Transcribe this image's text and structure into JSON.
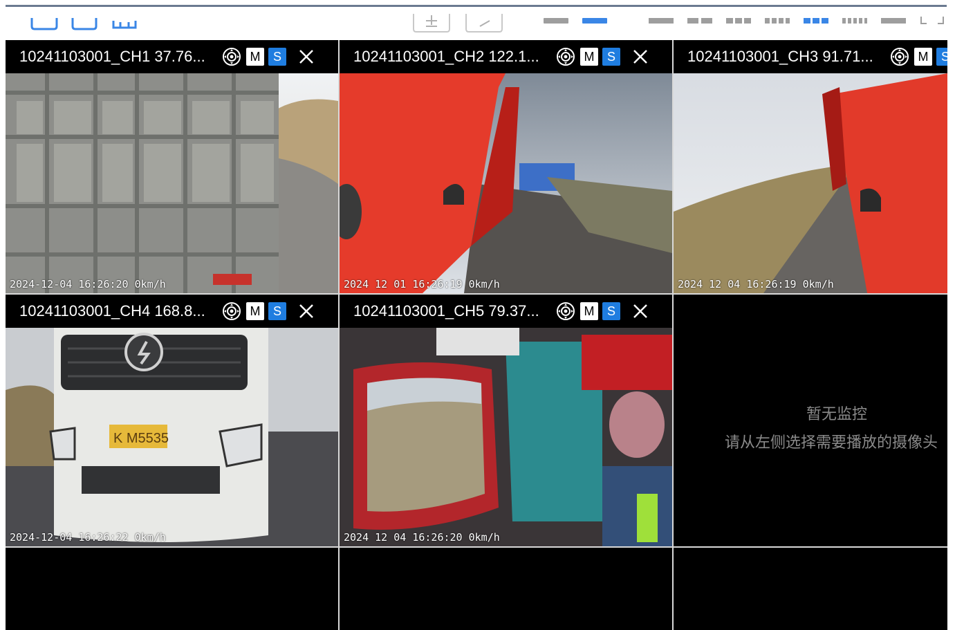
{
  "colors": {
    "accent": "#1f7de0",
    "grid_bg": "#000000",
    "divider": "#d9d9d9",
    "empty_text": "#8a8a8a"
  },
  "toolbar": {
    "left_icons": [
      "monitor-icon",
      "window-icon",
      "table-icon"
    ],
    "middle_icons": [
      "download-icon",
      "link-icon"
    ],
    "layout_icons": [
      "layout-1-icon",
      "layout-2-icon",
      "layout-4-icon",
      "layout-6-icon",
      "layout-8-icon",
      "layout-9-icon",
      "layout-12-icon",
      "layout-16-icon",
      "layout-custom-icon",
      "fullscreen-icon"
    ],
    "active_layout": "layout-9-icon"
  },
  "tiles": [
    {
      "title": "10241103001_CH1 37.76...",
      "timestamp": "2024-12-04 16:26:20 0km/h",
      "m_label": "M",
      "s_label": "S"
    },
    {
      "title": "10241103001_CH2 122.1...",
      "timestamp": "2024 12 01 16:26:19 0km/h",
      "m_label": "M",
      "s_label": "S"
    },
    {
      "title": "10241103001_CH3 91.71...",
      "timestamp": "2024 12 04 16:26:19 0km/h",
      "m_label": "M",
      "s_label": "S"
    },
    {
      "title": "10241103001_CH4 168.8...",
      "timestamp": "2024-12-04 16:26:22 0km/h",
      "m_label": "M",
      "s_label": "S"
    },
    {
      "title": "10241103001_CH5 79.37...",
      "timestamp": "2024 12 04 16:26:20 0km/h",
      "m_label": "M",
      "s_label": "S"
    }
  ],
  "empty": {
    "title": "暂无监控",
    "hint": "请从左侧选择需要播放的摄像头"
  },
  "plates": {
    "ch4": "K M5535"
  }
}
